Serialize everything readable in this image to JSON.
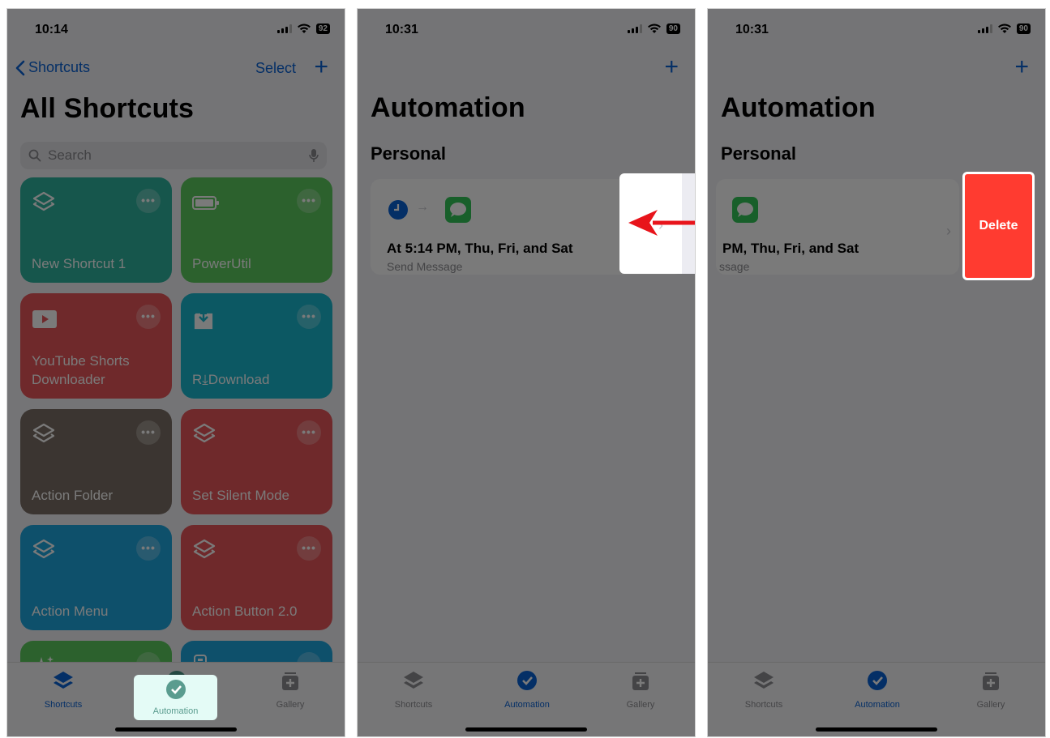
{
  "panel1": {
    "time": "10:14",
    "battery": "92",
    "back_label": "Shortcuts",
    "select_label": "Select",
    "plus": "+",
    "title": "All Shortcuts",
    "search_placeholder": "Search",
    "more_glyph": "•••",
    "tiles": [
      {
        "name": "New Shortcut 1",
        "color": "#2fb5a0",
        "icon": "layers-icon"
      },
      {
        "name": "PowerUtil",
        "color": "#5ccb5f",
        "icon": "battery-icon"
      },
      {
        "name": "YouTube Shorts Downloader",
        "color": "#e9575a",
        "icon": "youtube-icon"
      },
      {
        "name": "R⤓Download",
        "color": "#19b8d0",
        "icon": "download-icon"
      },
      {
        "name": "Action Folder",
        "color": "#7c7067",
        "icon": "layers-icon"
      },
      {
        "name": "Set Silent Mode",
        "color": "#e9575a",
        "icon": "layers-icon"
      },
      {
        "name": "Action Menu",
        "color": "#1fa7e0",
        "icon": "layers-icon"
      },
      {
        "name": "Action Button 2.0",
        "color": "#e9575a",
        "icon": "layers-icon"
      },
      {
        "name": "",
        "color": "#5ccb5f",
        "icon": "sparkles-icon"
      },
      {
        "name": "",
        "color": "#1fa7e0",
        "icon": "remote-icon"
      }
    ],
    "tabs": [
      {
        "label": "Shortcuts",
        "icon": "layers-icon"
      },
      {
        "label": "Automation",
        "icon": "clock-check-icon"
      },
      {
        "label": "Gallery",
        "icon": "gallery-icon"
      }
    ],
    "active_tab": "Automation"
  },
  "panel2": {
    "time": "10:31",
    "battery": "90",
    "plus": "+",
    "title": "Automation",
    "section": "Personal",
    "automation_title": "At 5:14 PM, Thu, Fri, and Sat",
    "automation_subtitle": "Send Message",
    "tabs": [
      {
        "label": "Shortcuts"
      },
      {
        "label": "Automation"
      },
      {
        "label": "Gallery"
      }
    ],
    "active_tab": "Automation",
    "arrow_color": "#e8141b"
  },
  "panel3": {
    "time": "10:31",
    "battery": "90",
    "plus": "+",
    "title": "Automation",
    "section": "Personal",
    "automation_title": "PM, Thu, Fri, and Sat",
    "automation_subtitle": "ssage",
    "delete_label": "Delete",
    "delete_color": "#ff3b30",
    "tabs": [
      {
        "label": "Shortcuts"
      },
      {
        "label": "Automation"
      },
      {
        "label": "Gallery"
      }
    ],
    "active_tab": "Automation"
  },
  "colors": {
    "accent": "#0a62d6",
    "messages_green": "#34c759",
    "clock_blue": "#0a62d6"
  }
}
